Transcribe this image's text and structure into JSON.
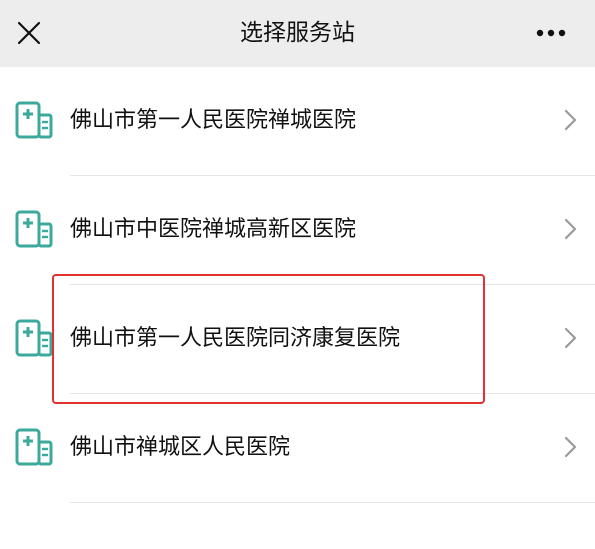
{
  "header": {
    "title": "选择服务站",
    "close_icon": "close-icon",
    "more_icon": "more-dots-icon"
  },
  "stations": [
    {
      "name": "佛山市第一人民医院禅城医院",
      "icon": "hospital-icon"
    },
    {
      "name": "佛山市中医院禅城高新区医院",
      "icon": "hospital-icon"
    },
    {
      "name": "佛山市第一人民医院同济康复医院",
      "icon": "hospital-icon"
    },
    {
      "name": "佛山市禅城区人民医院",
      "icon": "hospital-icon"
    }
  ],
  "highlighted_index": 2,
  "colors": {
    "icon_teal": "#3ba99c",
    "highlight_red": "#e0322f",
    "header_bg": "#ededed"
  }
}
